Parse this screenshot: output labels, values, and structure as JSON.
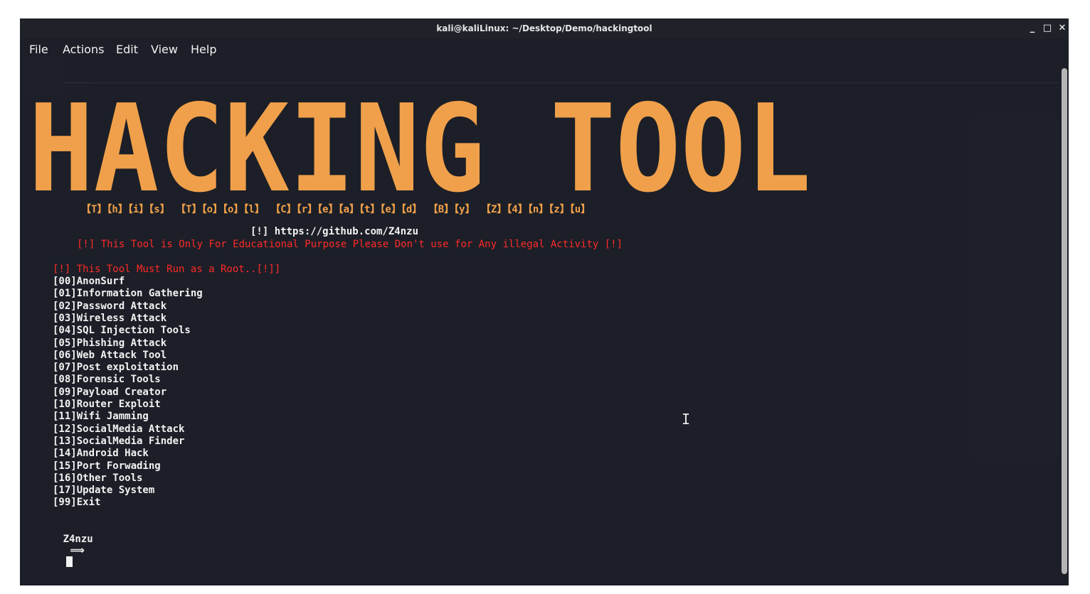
{
  "window": {
    "title": "kali@kaliLinux: ~/Desktop/Demo/hackingtool",
    "minimize": "_",
    "maximize": "□",
    "close": "✕"
  },
  "menubar": [
    "File",
    "Actions",
    "Edit",
    "View",
    "Help"
  ],
  "banner": {
    "text": "HACKING TOOL",
    "color": "#f0a04b",
    "credits": "【T】【h】【i】【s】 【T】【o】【o】【l】 【C】【r】【e】【a】【t】【e】【d】 【B】【y】 【Z】【4】【n】【z】【u】"
  },
  "github": "[!] https://github.com/Z4nzu",
  "warning": "[!] This Tool is Only For Educational Purpose Please Don't use for Any illegal Activity [!]",
  "root_warning": "[!] This Tool Must Run as a Root..[!]]",
  "menu_items": [
    "[00]AnonSurf",
    "[01]Information Gathering",
    "[02]Password Attack",
    "[03]Wireless Attack",
    "[04]SQL Injection Tools",
    "[05]Phishing Attack",
    "[06]Web Attack Tool",
    "[07]Post exploitation",
    "[08]Forensic Tools",
    "[09]Payload Creator",
    "[10]Router Exploit",
    "[11]Wifi Jamming",
    "[12]SocialMedia Attack",
    "[13]SocialMedia Finder",
    "[14]Android Hack",
    "[15]Port Forwading",
    "[16]Other Tools",
    "[17]Update System",
    "[99]Exit"
  ],
  "prompt": {
    "user": "Z4nzu",
    "arrow": "⟹"
  },
  "colors": {
    "background": "#1c1f27",
    "red": "#ff2a2a",
    "text": "#f2f2f2"
  }
}
